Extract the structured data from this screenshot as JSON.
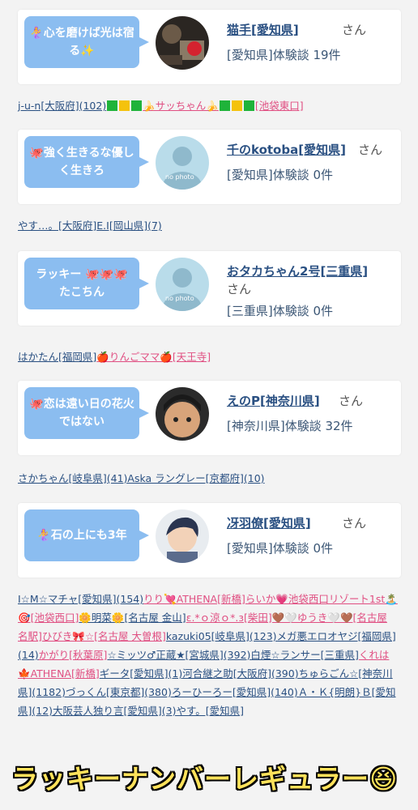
{
  "cards": [
    {
      "bubble": "🧜‍♀️心を磨けば光は宿る✨",
      "username": "猫手[愛知県]",
      "suffix": "さん",
      "meta": "[愛知県]体験談 19件"
    },
    {
      "bubble": "🐙強く生きるな優しく生きろ",
      "username": "千のkotoba[愛知県]",
      "suffix": "さん",
      "meta": "[愛知県]体験談 0件",
      "nophoto": "no photo"
    },
    {
      "bubble": "ラッキー 🐙🐙🐙 たこちん",
      "username": "おタカちゃん2号[三重県]",
      "suffix": "さん",
      "meta": "[三重県]体験談 0件",
      "nophoto": "no photo"
    },
    {
      "bubble": "🐙恋は遠い日の花火ではない",
      "username": "えのP[神奈川県]",
      "suffix": "さん",
      "meta": "[神奈川県]体験談 32件"
    },
    {
      "bubble": "🧜‍♀️石の上にも3年",
      "username": "冴羽僚[愛知県]",
      "suffix": "さん",
      "meta": "[愛知県]体験談 0件"
    }
  ],
  "strips": {
    "s1": {
      "a": "j-u-n[大阪府](102)",
      "b": "🍌サッちゃん🍌",
      "c": "[池袋東口]"
    },
    "s2": {
      "a": "やす…。[大阪府]",
      "b": "E.I[岡山県]",
      "c": "(7)"
    },
    "s3": {
      "a": "はかたん[福岡県]",
      "b": "🍎りんごママ🍎",
      "c": "[天王寺]"
    },
    "s4": {
      "a": "さかちゃん[岐阜県](41)",
      "b": "Aska ラングレー[京都府](10)"
    }
  },
  "cloud": [
    {
      "t": "I☆M☆マチャ[愛知県](154)",
      "pink": false
    },
    {
      "t": "りり💘ATHENA[新橋]",
      "pink": true
    },
    {
      "t": "らいか💗池袋西口リゾート1st🏝️🎯[池袋西口]",
      "pink": true
    },
    {
      "t": "🌼明菜🌼[名古屋 金山]",
      "pink": false
    },
    {
      "t": "ε.*ｏ涼ｏ*.з[柴田]🤎🤍ゆうき🤍🤎[名古屋 名駅]",
      "pink": true
    },
    {
      "t": "ひびき🎀☆[名古屋 大曽根]",
      "pink": true
    },
    {
      "t": "kazuki05[岐阜県](123)",
      "pink": false
    },
    {
      "t": "メガ悪エロオヤジ[福岡県](14)",
      "pink": false
    },
    {
      "t": "かがり[秋葉原]",
      "pink": true
    },
    {
      "t": "☆ミッツ♂正蔵★[宮城県](392)",
      "pink": false
    },
    {
      "t": "白煙☆ランサー[三重県]",
      "pink": false
    },
    {
      "t": "くれは🍁ATHENA[新橋]",
      "pink": true
    },
    {
      "t": "ギータ[愛知県](1)",
      "pink": false
    },
    {
      "t": "河合継之助[大阪府](390)",
      "pink": false
    },
    {
      "t": "ちゅらごん☆[神奈川県](1182)",
      "pink": false
    },
    {
      "t": "づっくん[東京都](380)",
      "pink": false
    },
    {
      "t": "ろーひーろー[愛知県](140)",
      "pink": false
    },
    {
      "t": "Ａ・Ｋ{明朗}Ｂ[愛知県](12)",
      "pink": false
    },
    {
      "t": "大阪芸人独り言[愛知県](3)",
      "pink": false
    },
    {
      "t": "やす。[愛知県]",
      "pink": false
    }
  ],
  "footer": "ラッキーナンバーレギュラー😆",
  "colors": {
    "bubble": "#8bbdf0",
    "link": "#2a5082",
    "pink": "#e04f82",
    "footer": "#ffe25a"
  }
}
